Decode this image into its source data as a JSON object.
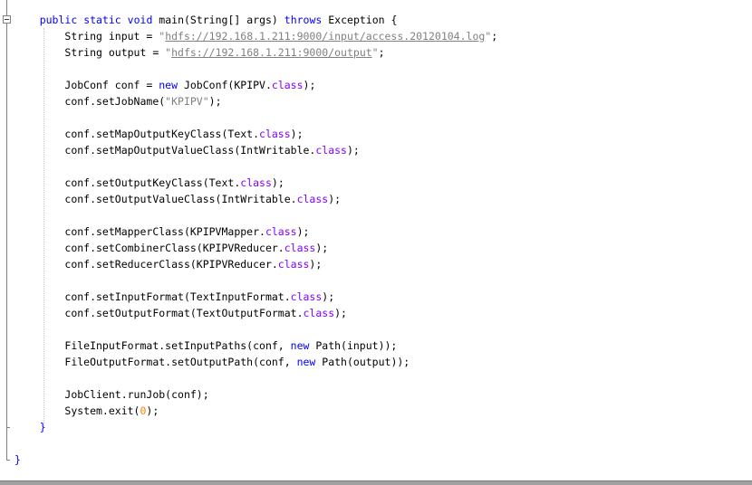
{
  "code": {
    "lines": [
      {
        "indent": "    ",
        "tokens": [
          [
            "kw",
            "public"
          ],
          [
            "t",
            " "
          ],
          [
            "kw",
            "static"
          ],
          [
            "t",
            " "
          ],
          [
            "kw",
            "void"
          ],
          [
            "t",
            " main(String[] args) "
          ],
          [
            "kw",
            "throws"
          ],
          [
            "t",
            " Exception {"
          ]
        ]
      },
      {
        "indent": "        ",
        "tokens": [
          [
            "t",
            "String input = "
          ],
          [
            "str",
            "\""
          ],
          [
            "url",
            "hdfs://192.168.1.211:9000/input/access.20120104.log"
          ],
          [
            "str",
            "\""
          ],
          [
            "t",
            ";"
          ]
        ]
      },
      {
        "indent": "        ",
        "tokens": [
          [
            "t",
            "String output = "
          ],
          [
            "str",
            "\""
          ],
          [
            "url",
            "hdfs://192.168.1.211:9000/output"
          ],
          [
            "str",
            "\""
          ],
          [
            "t",
            ";"
          ]
        ]
      },
      {
        "indent": "",
        "tokens": []
      },
      {
        "indent": "        ",
        "tokens": [
          [
            "t",
            "JobConf conf = "
          ],
          [
            "kw",
            "new"
          ],
          [
            "t",
            " JobConf(KPIPV."
          ],
          [
            "kw2",
            "class"
          ],
          [
            "t",
            ");"
          ]
        ]
      },
      {
        "indent": "        ",
        "tokens": [
          [
            "t",
            "conf.setJobName("
          ],
          [
            "str",
            "\"KPIPV\""
          ],
          [
            "t",
            ");"
          ]
        ]
      },
      {
        "indent": "",
        "tokens": []
      },
      {
        "indent": "        ",
        "tokens": [
          [
            "t",
            "conf.setMapOutputKeyClass(Text."
          ],
          [
            "kw2",
            "class"
          ],
          [
            "t",
            ");"
          ]
        ]
      },
      {
        "indent": "        ",
        "tokens": [
          [
            "t",
            "conf.setMapOutputValueClass(IntWritable."
          ],
          [
            "kw2",
            "class"
          ],
          [
            "t",
            ");"
          ]
        ]
      },
      {
        "indent": "",
        "tokens": []
      },
      {
        "indent": "        ",
        "tokens": [
          [
            "t",
            "conf.setOutputKeyClass(Text."
          ],
          [
            "kw2",
            "class"
          ],
          [
            "t",
            ");"
          ]
        ]
      },
      {
        "indent": "        ",
        "tokens": [
          [
            "t",
            "conf.setOutputValueClass(IntWritable."
          ],
          [
            "kw2",
            "class"
          ],
          [
            "t",
            ");"
          ]
        ]
      },
      {
        "indent": "",
        "tokens": []
      },
      {
        "indent": "        ",
        "tokens": [
          [
            "t",
            "conf.setMapperClass(KPIPVMapper."
          ],
          [
            "kw2",
            "class"
          ],
          [
            "t",
            ");"
          ]
        ]
      },
      {
        "indent": "        ",
        "tokens": [
          [
            "t",
            "conf.setCombinerClass(KPIPVReducer."
          ],
          [
            "kw2",
            "class"
          ],
          [
            "t",
            ");"
          ]
        ]
      },
      {
        "indent": "        ",
        "tokens": [
          [
            "t",
            "conf.setReducerClass(KPIPVReducer."
          ],
          [
            "kw2",
            "class"
          ],
          [
            "t",
            ");"
          ]
        ]
      },
      {
        "indent": "",
        "tokens": []
      },
      {
        "indent": "        ",
        "tokens": [
          [
            "t",
            "conf.setInputFormat(TextInputFormat."
          ],
          [
            "kw2",
            "class"
          ],
          [
            "t",
            ");"
          ]
        ]
      },
      {
        "indent": "        ",
        "tokens": [
          [
            "t",
            "conf.setOutputFormat(TextOutputFormat."
          ],
          [
            "kw2",
            "class"
          ],
          [
            "t",
            ");"
          ]
        ]
      },
      {
        "indent": "",
        "tokens": []
      },
      {
        "indent": "        ",
        "tokens": [
          [
            "t",
            "FileInputFormat.setInputPaths(conf, "
          ],
          [
            "kw",
            "new"
          ],
          [
            "t",
            " Path(input));"
          ]
        ]
      },
      {
        "indent": "        ",
        "tokens": [
          [
            "t",
            "FileOutputFormat.setOutputPath(conf, "
          ],
          [
            "kw",
            "new"
          ],
          [
            "t",
            " Path(output));"
          ]
        ]
      },
      {
        "indent": "",
        "tokens": []
      },
      {
        "indent": "        ",
        "tokens": [
          [
            "t",
            "JobClient.runJob(conf);"
          ]
        ]
      },
      {
        "indent": "        ",
        "tokens": [
          [
            "t",
            "System.exit("
          ],
          [
            "num",
            "0"
          ],
          [
            "t",
            ");"
          ]
        ]
      },
      {
        "indent": "    ",
        "tokens": [
          [
            "kw",
            "}"
          ]
        ]
      },
      {
        "indent": "",
        "tokens": []
      },
      {
        "indent": "",
        "tokens": [
          [
            "kw",
            "}"
          ]
        ]
      }
    ]
  },
  "colors": {
    "keyword": "#0000ff",
    "class_keyword": "#8000ff",
    "string": "#808080",
    "number": "#ff8000",
    "text": "#000000",
    "background": "#ffffff"
  },
  "icons": {
    "fold_toggle": "fold-collapse-icon"
  }
}
